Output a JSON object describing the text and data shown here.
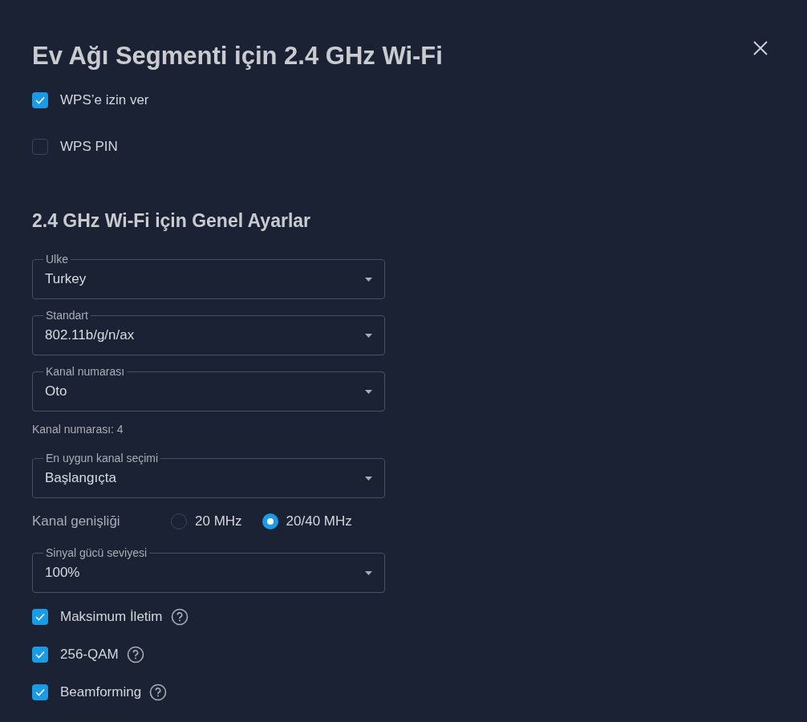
{
  "title": "Ev Ağı Segmenti için 2.4 GHz Wi-Fi",
  "top_options": [
    {
      "label": "WPS’e izin ver",
      "checked": true
    },
    {
      "label": "WPS PIN",
      "checked": false
    }
  ],
  "section_title": "2.4 GHz Wi-Fi için Genel Ayarlar",
  "fields": [
    {
      "kind": "select",
      "label": "Ulke",
      "value": "Turkey"
    },
    {
      "kind": "select",
      "label": "Standart",
      "value": "802.11b/g/n/ax"
    },
    {
      "kind": "select",
      "label": "Kanal numarası",
      "value": "Oto"
    },
    {
      "kind": "note",
      "text": "Kanal numarası: 4"
    },
    {
      "kind": "select",
      "label": "En uygun kanal seçimi",
      "value": "Başlangıçta"
    },
    {
      "kind": "radio",
      "label": "Kanal genişliği",
      "options": [
        {
          "label": "20 MHz",
          "selected": false
        },
        {
          "label": "20/40 MHz",
          "selected": true
        }
      ]
    },
    {
      "kind": "select",
      "label": "Sinyal gücü seviyesi",
      "value": "100%"
    },
    {
      "kind": "checkbox",
      "label": "Maksimum İletim",
      "checked": true,
      "help": true
    },
    {
      "kind": "checkbox",
      "label": "256-QAM",
      "checked": true,
      "help": true
    },
    {
      "kind": "checkbox",
      "label": "Beamforming",
      "checked": true,
      "help": true
    }
  ]
}
